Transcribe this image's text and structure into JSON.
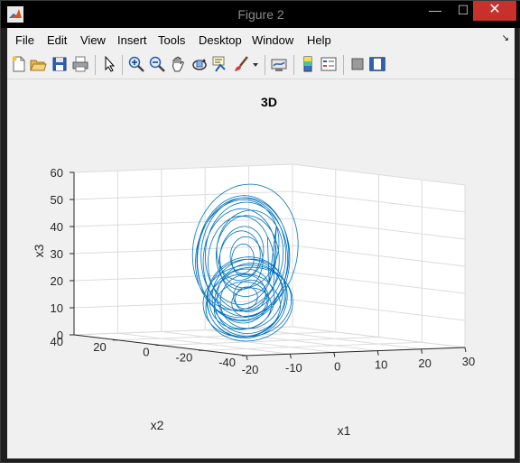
{
  "window": {
    "title": "Figure 2",
    "minimize_glyph": "—",
    "maximize_glyph": "☐",
    "close_glyph": "✕"
  },
  "menu": {
    "items": [
      "File",
      "Edit",
      "View",
      "Insert",
      "Tools",
      "Desktop",
      "Window",
      "Help"
    ],
    "dock_glyph": "↘"
  },
  "toolbar": {
    "buttons": [
      "new-figure-icon",
      "open-file-icon",
      "save-icon",
      "print-icon",
      "edit-plot-arrow-icon",
      "zoom-in-icon",
      "zoom-out-icon",
      "pan-hand-icon",
      "rotate-3d-icon",
      "data-cursor-icon",
      "brush-icon",
      "brush-dropdown-icon",
      "link-plot-icon",
      "insert-colorbar-icon",
      "insert-legend-icon",
      "hide-plot-tools-icon",
      "show-plot-tools-icon"
    ]
  },
  "chart_data": {
    "type": "line3d",
    "title": "3D",
    "xlabel": "x1",
    "ylabel": "x2",
    "zlabel": "x3",
    "xlim": [
      -20,
      30
    ],
    "ylim": [
      -40,
      40
    ],
    "zlim": [
      0,
      60
    ],
    "x_ticks": [
      "-20",
      "-10",
      "0",
      "10",
      "20",
      "30"
    ],
    "y_ticks": [
      "-40",
      "-20",
      "0",
      "20",
      "40"
    ],
    "z_ticks": [
      "0",
      "10",
      "20",
      "30",
      "40",
      "50",
      "60"
    ],
    "grid": true,
    "line_color": "#0072bd"
  }
}
